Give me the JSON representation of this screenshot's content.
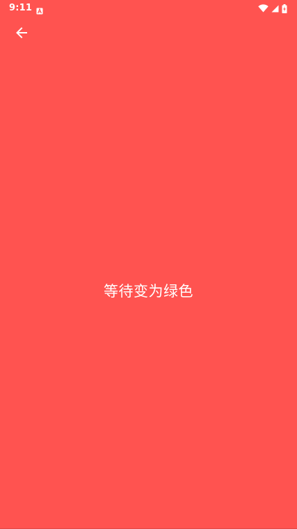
{
  "status_bar": {
    "time": "9:11",
    "notification_icon": "a-badge-icon",
    "wifi_icon": "wifi-icon",
    "signal_icon": "cell-signal-icon",
    "battery_icon": "battery-charging-icon"
  },
  "toolbar": {
    "back_icon": "arrow-left-icon"
  },
  "main": {
    "message": "等待变为绿色"
  },
  "colors": {
    "background": "#FF5350",
    "foreground": "#FFFFFF"
  }
}
